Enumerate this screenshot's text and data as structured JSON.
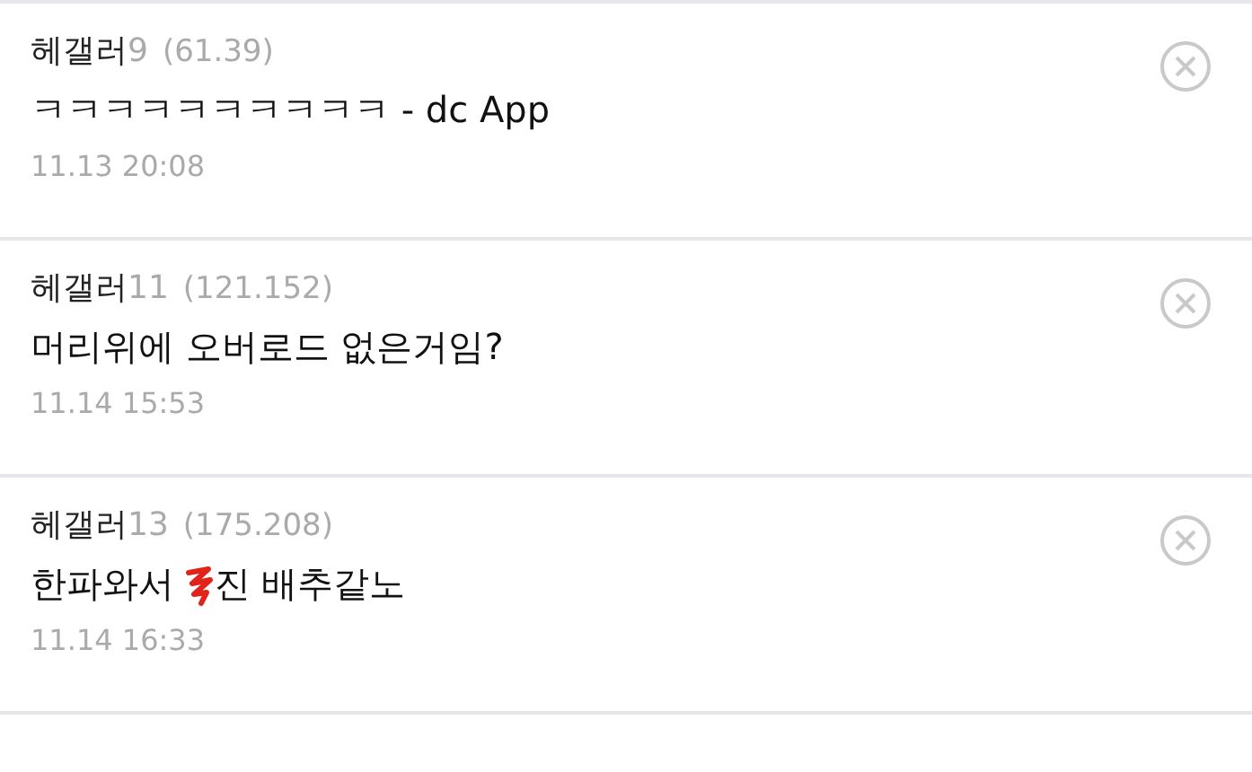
{
  "comments": [
    {
      "nickname": "헤갤러",
      "suffix": "9",
      "ip": "(61.39)",
      "body": [
        {
          "kind": "text",
          "text": "ㅋㅋㅋㅋㅋㅋㅋㅋㅋㅋ - dc App"
        }
      ],
      "time": "11.13 20:08"
    },
    {
      "nickname": "헤갤러",
      "suffix": "11",
      "ip": "(121.152)",
      "body": [
        {
          "kind": "text",
          "text": "머리위에 오버로드 없은거임?"
        }
      ],
      "time": "11.14 15:53"
    },
    {
      "nickname": "헤갤러",
      "suffix": "13",
      "ip": "(175.208)",
      "body": [
        {
          "kind": "text",
          "text": "한파와서 "
        },
        {
          "kind": "redaction"
        },
        {
          "kind": "text",
          "text": "진 배추같노"
        }
      ],
      "time": "11.14 16:33"
    }
  ]
}
